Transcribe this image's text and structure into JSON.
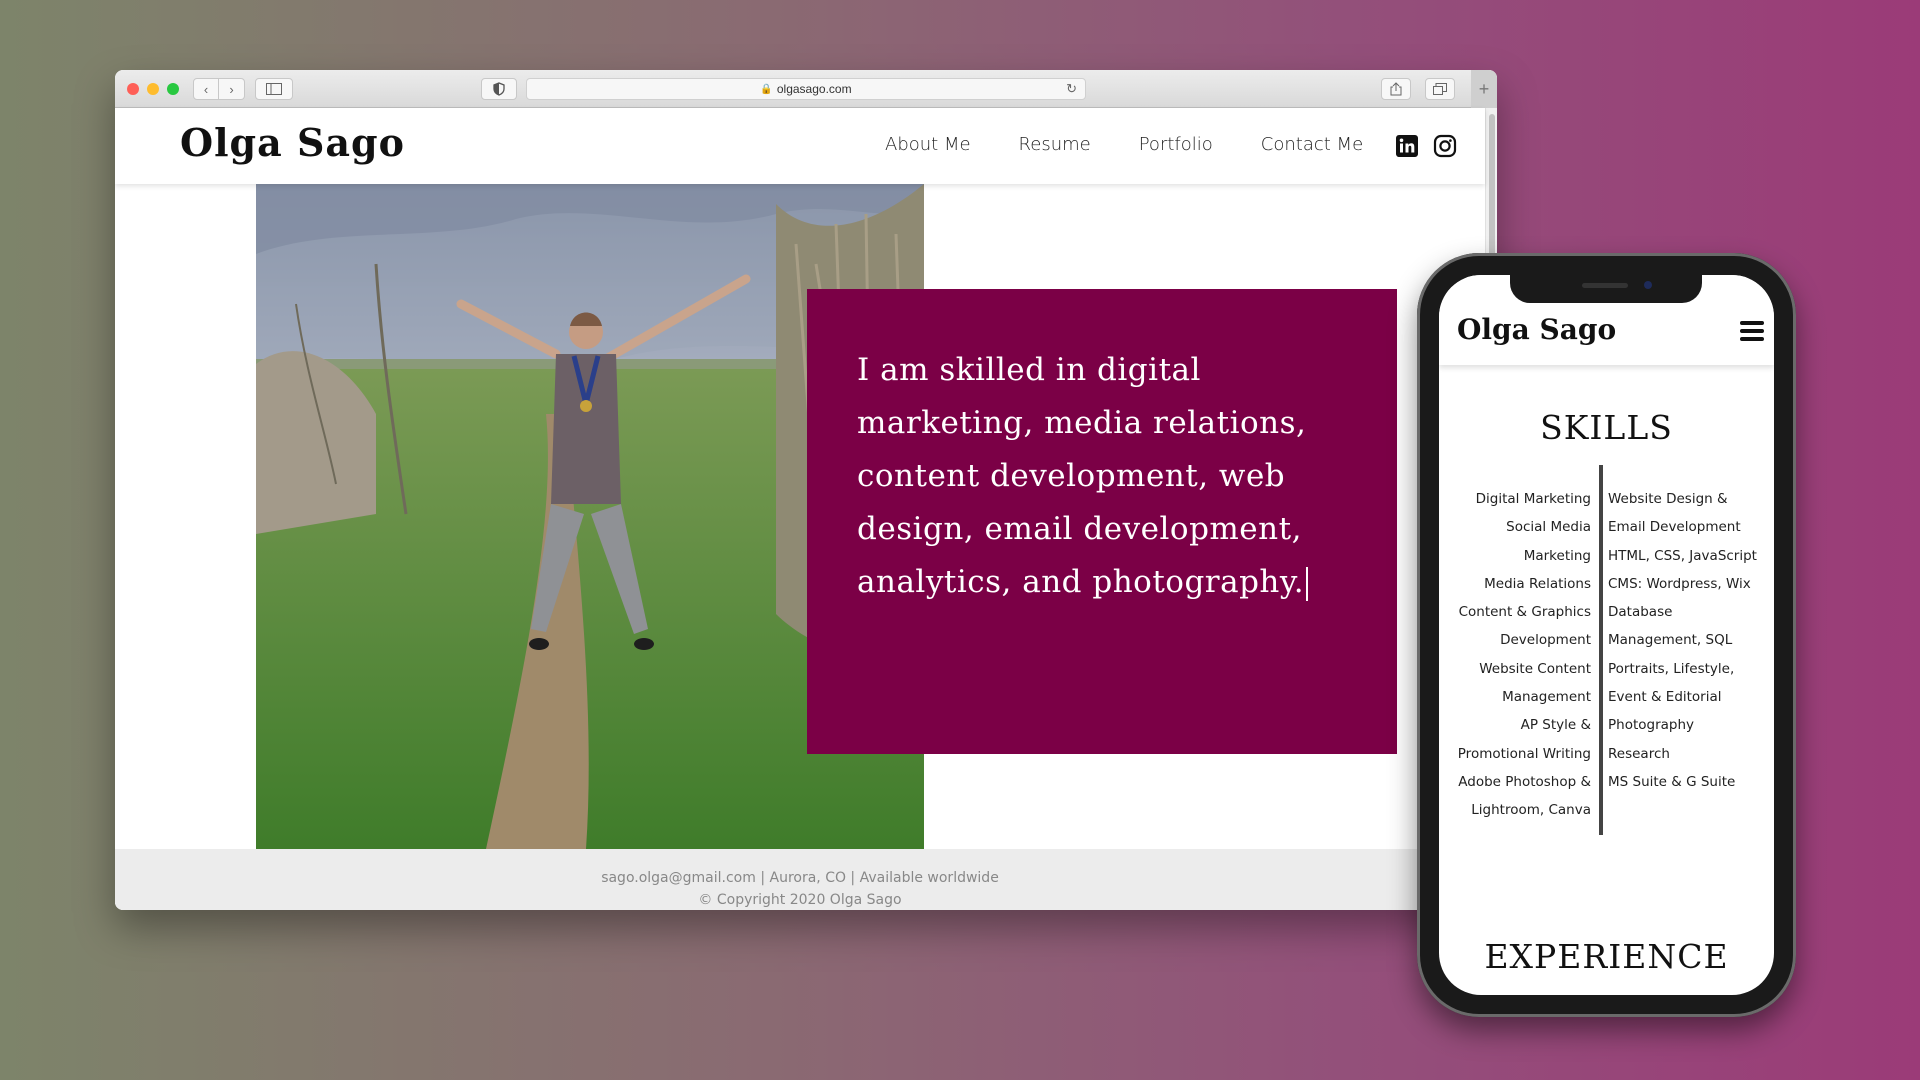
{
  "browser": {
    "url": "olgasago.com"
  },
  "site": {
    "logo": "Olga Sago",
    "nav": [
      "About Me",
      "Resume",
      "Portfolio",
      "Contact Me"
    ],
    "social_icons": [
      "linkedin-icon",
      "instagram-icon"
    ],
    "hero_quote": "I am skilled in digital marketing, media relations, content development, web design, email development, analytics, and photography.",
    "brand_color": "#7b0046",
    "footer": {
      "line1": "sago.olga@gmail.com | Aurora, CO | Available worldwide",
      "line2": "© Copyright 2020 Olga Sago"
    }
  },
  "mobile": {
    "logo": "Olga Sago",
    "menu_icon": "hamburger-icon",
    "skills_title": "SKILLS",
    "skills_left": [
      "Digital Marketing",
      "Social Media",
      "Marketing",
      "Media Relations",
      "Content & Graphics",
      "Development",
      "Website Content",
      "Management",
      "AP Style &",
      "Promotional Writing",
      "Adobe Photoshop &",
      "Lightroom, Canva"
    ],
    "skills_right": [
      "Website Design &",
      "Email Development",
      "HTML, CSS, JavaScript",
      "CMS: Wordpress, Wix",
      "Database",
      "Management, SQL",
      "Portraits, Lifestyle,",
      "Event & Editorial",
      "Photography",
      "Research",
      "MS Suite & G Suite"
    ],
    "experience_title": "EXPERIENCE"
  }
}
